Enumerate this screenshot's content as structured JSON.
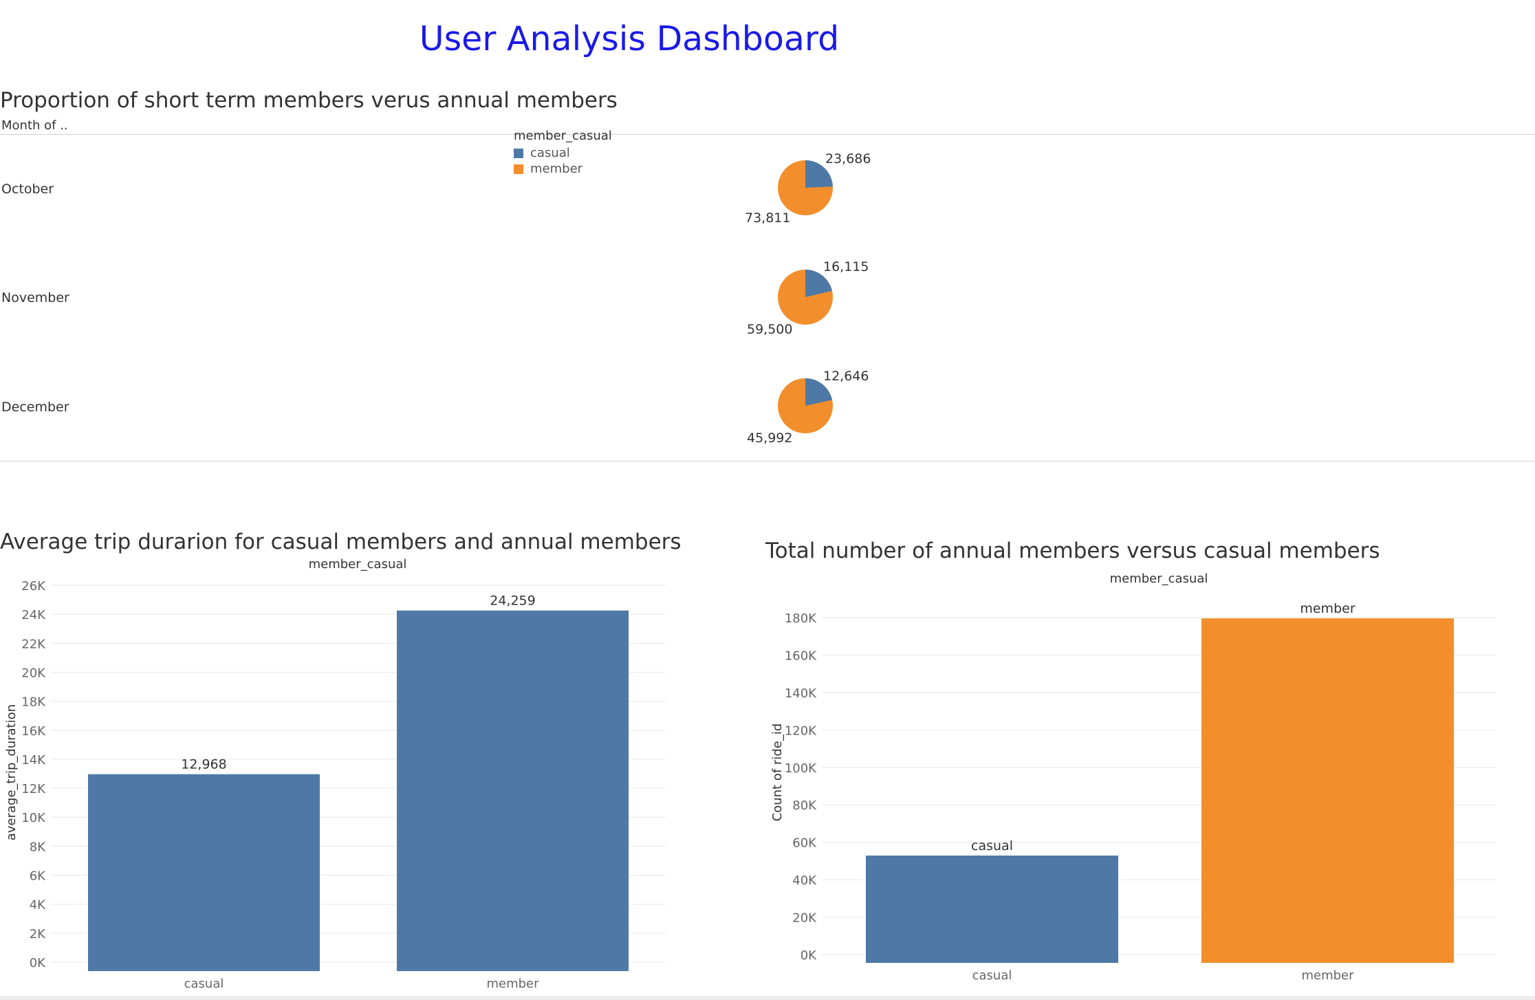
{
  "dashboard_title": "User Analysis Dashboard",
  "colors": {
    "title": "#1a1ae6",
    "casual": "#4e79a7",
    "member": "#f28e2b",
    "grid": "#ececec",
    "axis_text": "#666666"
  },
  "pie_section": {
    "title": "Proportion of short term members verus annual members",
    "row_header": "Month of ..",
    "legend": {
      "title": "member_casual",
      "items": [
        {
          "label": "casual"
        },
        {
          "label": "member"
        }
      ]
    },
    "months": [
      {
        "month": "October",
        "casual_label": "23,686",
        "member_label": "73,811"
      },
      {
        "month": "November",
        "casual_label": "16,115",
        "member_label": "59,500"
      },
      {
        "month": "December",
        "casual_label": "12,646",
        "member_label": "45,992"
      }
    ]
  },
  "bar_left": {
    "title": "Average trip durarion for casual members and annual members",
    "header": "member_casual",
    "ylabel": "average_trip_duration",
    "ticks": [
      "0K",
      "2K",
      "4K",
      "6K",
      "8K",
      "10K",
      "12K",
      "14K",
      "16K",
      "18K",
      "20K",
      "22K",
      "24K",
      "26K"
    ],
    "categories": [
      "casual",
      "member"
    ],
    "value_labels": [
      "12,968",
      "24,259"
    ]
  },
  "bar_right": {
    "title": "Total number of annual members versus casual members",
    "header": "member_casual",
    "ylabel": "Count of ride_id",
    "ticks": [
      "0K",
      "20K",
      "40K",
      "60K",
      "80K",
      "100K",
      "120K",
      "140K",
      "160K",
      "180K"
    ],
    "categories": [
      "casual",
      "member"
    ],
    "top_labels": [
      "casual",
      "member"
    ]
  },
  "chart_data": [
    {
      "type": "pie",
      "title": "Proportion of short term members verus annual members",
      "legend_title": "member_casual",
      "categories": [
        "casual",
        "member"
      ],
      "series": [
        {
          "name": "October",
          "values": [
            23686,
            73811
          ]
        },
        {
          "name": "November",
          "values": [
            16115,
            59500
          ]
        },
        {
          "name": "December",
          "values": [
            12646,
            45992
          ]
        }
      ]
    },
    {
      "type": "bar",
      "title": "Average trip durarion for casual members and annual members",
      "xlabel": "member_casual",
      "ylabel": "average_trip_duration",
      "categories": [
        "casual",
        "member"
      ],
      "values": [
        12968,
        24259
      ],
      "ylim": [
        0,
        26000
      ],
      "grid": true
    },
    {
      "type": "bar",
      "title": "Total number of annual members versus casual members",
      "xlabel": "member_casual",
      "ylabel": "Count of ride_id",
      "categories": [
        "casual",
        "member"
      ],
      "values": [
        52900,
        179600
      ],
      "ylim": [
        0,
        180000
      ],
      "grid": true
    }
  ]
}
